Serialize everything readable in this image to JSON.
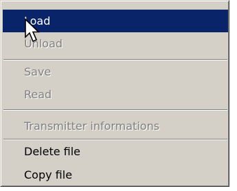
{
  "menu": {
    "items": [
      {
        "label": "Load",
        "state": "highlighted"
      },
      {
        "label": "Unload",
        "state": "disabled"
      },
      {
        "label": "Save",
        "state": "disabled"
      },
      {
        "label": "Read",
        "state": "disabled"
      },
      {
        "label": "Transmitter informations",
        "state": "disabled"
      },
      {
        "label": "Delete file",
        "state": "enabled"
      },
      {
        "label": "Copy file",
        "state": "enabled"
      }
    ]
  },
  "colors": {
    "menu_background": "#d4d0c8",
    "highlight_background": "#0a246a",
    "highlight_text": "#ffffff",
    "disabled_text": "#808080",
    "enabled_text": "#000000"
  },
  "icons": {
    "pointer": "mouse-pointer-arrow"
  }
}
